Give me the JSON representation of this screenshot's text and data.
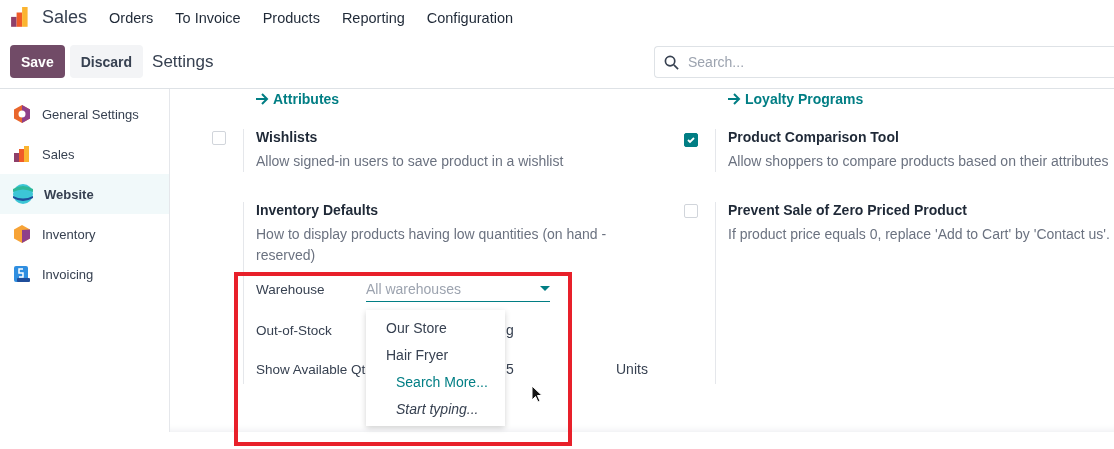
{
  "navbar": {
    "app_name": "Sales",
    "menu": [
      "Orders",
      "To Invoice",
      "Products",
      "Reporting",
      "Configuration"
    ]
  },
  "control_bar": {
    "buttons": [
      {
        "label": "Save",
        "kind": "primary"
      },
      {
        "label": "Discard",
        "kind": "secondary"
      }
    ],
    "breadcrumb": "Settings",
    "search": {
      "placeholder": "Search..."
    }
  },
  "sidebar": {
    "items": [
      {
        "label": "General Settings",
        "selected": false
      },
      {
        "label": "Sales",
        "selected": false
      },
      {
        "label": "Website",
        "selected": true
      },
      {
        "label": "Inventory",
        "selected": false
      },
      {
        "label": "Invoicing",
        "selected": false
      }
    ]
  },
  "settings": {
    "links": [
      "Attributes",
      "Loyalty Programs"
    ],
    "rows": [
      [
        {
          "kind": "checkbox",
          "checked": false,
          "title": "Wishlists",
          "description": "Allow signed-in users to save product in a wishlist"
        },
        {
          "kind": "checkbox",
          "checked": true,
          "title": "Product Comparison Tool",
          "description": "Allow shoppers to compare products based on their attributes"
        }
      ],
      [
        {
          "kind": "plain",
          "title": "Inventory Defaults",
          "description": "How to display products having low quantities (on hand - reserved)",
          "fields": {
            "warehouse": {
              "label": "Warehouse",
              "placeholder": "All warehouses"
            },
            "out_of_stock": {
              "label": "Out-of-Stock",
              "value_visible": "g"
            },
            "show_qty": {
              "label": "Show Available Qt",
              "value_visible": "5",
              "unit": "Units"
            }
          }
        },
        {
          "kind": "checkbox",
          "checked": false,
          "title": "Prevent Sale of Zero Priced Product",
          "description": "If product price equals 0, replace 'Add to Cart' by 'Contact us'."
        }
      ]
    ]
  },
  "dropdown": {
    "options": [
      {
        "label": "Our Store",
        "kind": "option"
      },
      {
        "label": "Hair Fryer",
        "kind": "option"
      },
      {
        "label": "Search More...",
        "kind": "action"
      },
      {
        "label": "Start typing...",
        "kind": "hint"
      }
    ]
  },
  "annotation": {
    "kind": "highlight"
  }
}
